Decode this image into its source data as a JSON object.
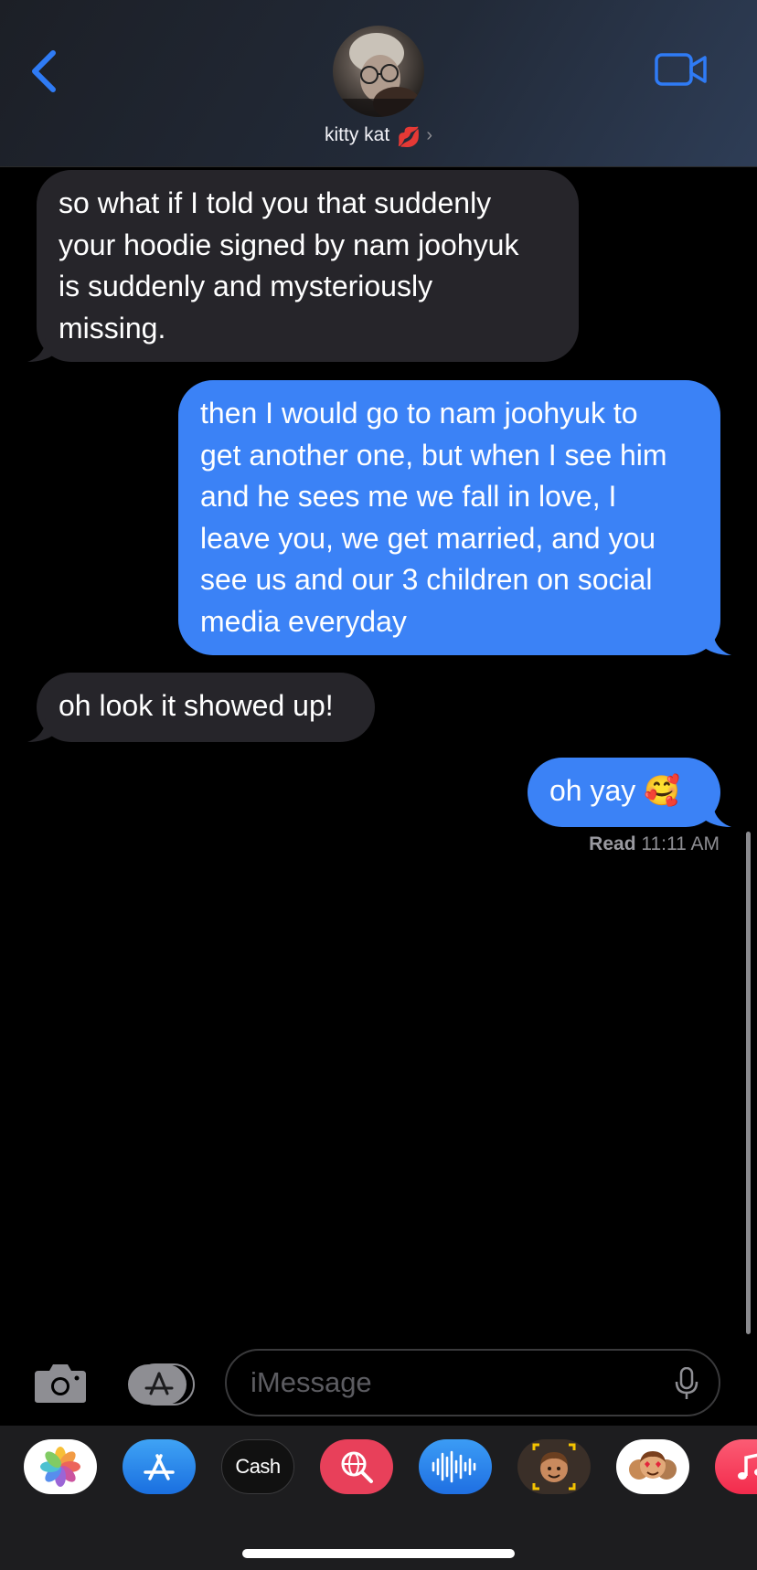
{
  "header": {
    "contact_name": "kitty kat",
    "contact_emoji": "💋"
  },
  "messages": [
    {
      "direction": "received",
      "text": "so what if I told you that suddenly\nyour hoodie signed by nam joohyuk\nis suddenly and mysteriously\nmissing."
    },
    {
      "direction": "sent",
      "text": "then I would go to nam joohyuk to\nget another one, but when I see him\nand he sees me we fall in love, I\nleave you, we get married, and you\nsee us and our 3 children on social\nmedia everyday"
    },
    {
      "direction": "received",
      "text": "oh look it showed up!"
    },
    {
      "direction": "sent",
      "text": "oh yay 🥰"
    }
  ],
  "receipt": {
    "label": "Read",
    "time": "11:11 AM"
  },
  "composer": {
    "placeholder": "iMessage"
  },
  "app_drawer": [
    {
      "name": "Photos"
    },
    {
      "name": "App Store"
    },
    {
      "name": "Cash",
      "label": "Cash"
    },
    {
      "name": "Web Search"
    },
    {
      "name": "Audio Messages"
    },
    {
      "name": "Memoji"
    },
    {
      "name": "Memoji Stickers"
    },
    {
      "name": "Music"
    }
  ],
  "colors": {
    "sent_bubble": "#3b82f6",
    "received_bubble": "#26252a",
    "accent": "#2f7bf5",
    "background": "#000000"
  }
}
